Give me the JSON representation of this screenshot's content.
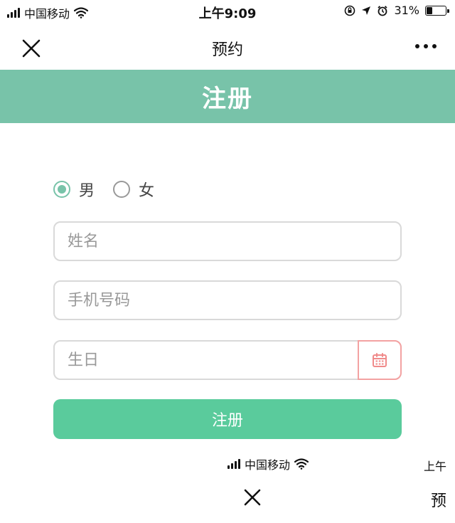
{
  "status_bar": {
    "carrier": "中国移动",
    "time": "上午9:09",
    "battery_percent": "31%",
    "battery_level": 0.31,
    "icons": [
      "signal-icon",
      "wifi-icon",
      "location-icon",
      "alarm-icon",
      "orientation-lock-icon",
      "battery-icon"
    ]
  },
  "nav": {
    "title": "预约",
    "close_icon": "close-icon",
    "more_icon": "more-icon"
  },
  "banner": {
    "title": "注册"
  },
  "form": {
    "gender_options": [
      {
        "label": "男",
        "checked": true
      },
      {
        "label": "女",
        "checked": false
      }
    ],
    "name_placeholder": "姓名",
    "phone_placeholder": "手机号码",
    "birthday_placeholder": "生日",
    "calendar_icon": "calendar-icon",
    "submit_label": "注册"
  },
  "overlay_fragment": {
    "carrier": "中国移动",
    "time": "上午",
    "nav_title": "预"
  },
  "colors": {
    "banner": "#78c3a9",
    "submit": "#5acb9c",
    "radio_checked": "#78c3a9",
    "calendar_border": "#f3a2a2"
  }
}
